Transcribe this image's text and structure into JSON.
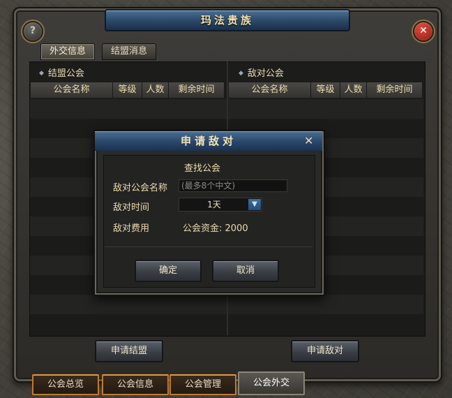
{
  "window": {
    "title": "玛法贵族",
    "help_label": "?",
    "close_label": "✕"
  },
  "top_tabs": [
    {
      "label": "外交信息"
    },
    {
      "label": "结盟消息"
    }
  ],
  "alliance_section": {
    "title": "结盟公会",
    "columns": [
      "公会名称",
      "等级",
      "人数",
      "剩余时间"
    ]
  },
  "hostile_section": {
    "title": "敌对公会",
    "columns": [
      "公会名称",
      "等级",
      "人数",
      "剩余时间"
    ]
  },
  "bottom_buttons": {
    "apply_alliance": "申请结盟",
    "apply_hostile": "申请敌对"
  },
  "bottom_tabs": [
    {
      "label": "公会总览"
    },
    {
      "label": "公会信息"
    },
    {
      "label": "公会管理"
    },
    {
      "label": "公会外交"
    }
  ],
  "dialog": {
    "title": "申请敌对",
    "close_label": "✕",
    "subtitle": "查找公会",
    "name_label": "敌对公会名称",
    "name_placeholder": "(最多8个中文)",
    "time_label": "敌对时间",
    "time_value": "1天",
    "cost_label": "敌对费用",
    "cost_value": "公会资金: 2000",
    "confirm_label": "确定",
    "cancel_label": "取消"
  }
}
